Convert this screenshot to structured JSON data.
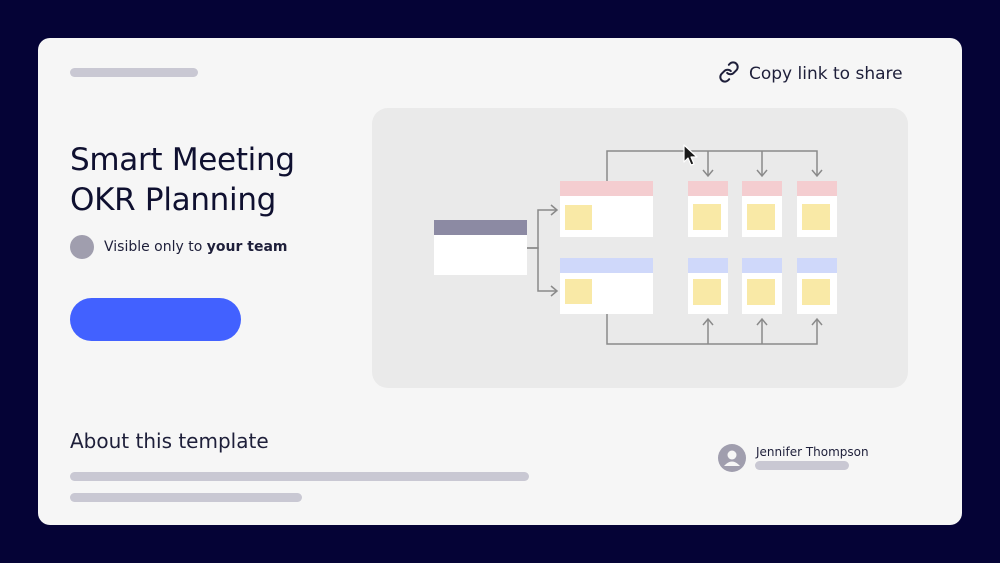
{
  "header": {
    "copy_link_label": "Copy link to share",
    "link_icon": "link-icon"
  },
  "template": {
    "title_line1": "Smart Meeting",
    "title_line2": "OKR Planning",
    "visibility_prefix": "Visible only to ",
    "visibility_audience": "your team"
  },
  "about": {
    "heading": "About this template"
  },
  "author": {
    "name": "Jennifer Thompson",
    "avatar_icon": "user-avatar-icon"
  },
  "colors": {
    "page_background": "#050336",
    "card_background": "#f6f6f6",
    "primary_button": "#4261ff",
    "placeholder": "#c9c8d3",
    "preview_background": "#eaeaea",
    "objective_header": "#8c8aa3",
    "red_header": "#f4cdd0",
    "blue_header": "#cfd8fa",
    "sticky_note": "#f9e9a6"
  }
}
